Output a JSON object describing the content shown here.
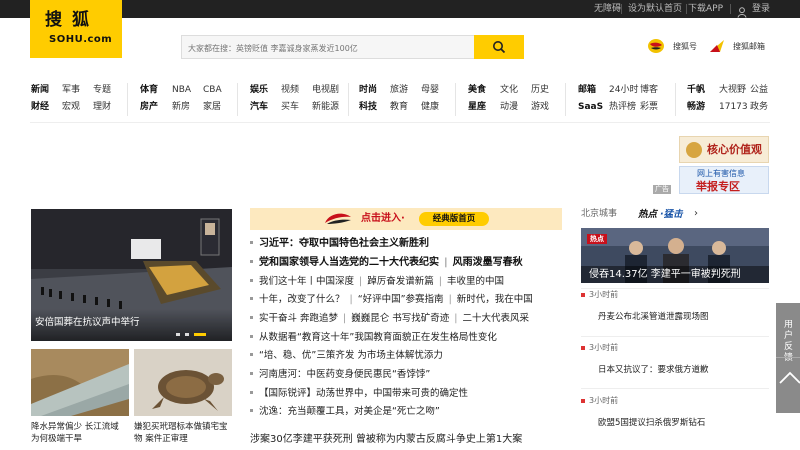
{
  "topbar": {
    "links": [
      "无障碍",
      "设为默认首页",
      "下载APP",
      "登录"
    ]
  },
  "logo": {
    "cn": "搜狐",
    "en": "SOHU.com"
  },
  "search": {
    "placeholder": "大家都在搜：英镑贬值 李嘉诚身家蒸发近100亿"
  },
  "header_links": {
    "sohuhao": "搜狐号",
    "mail": "搜狐邮箱"
  },
  "nav": {
    "groups": [
      {
        "row1": [
          "新闻",
          "军事",
          "专题"
        ],
        "row2": [
          "财经",
          "宏观",
          "理财"
        ]
      },
      {
        "row1": [
          "体育",
          "NBA",
          "CBA"
        ],
        "row2": [
          "房产",
          "新房",
          "家居"
        ]
      },
      {
        "row1": [
          "娱乐",
          "视频",
          "电视剧"
        ],
        "row2": [
          "汽车",
          "买车",
          "新能源"
        ]
      },
      {
        "row1": [
          "时尚",
          "旅游",
          "母婴"
        ],
        "row2": [
          "科技",
          "教育",
          "健康"
        ]
      },
      {
        "row1": [
          "美食",
          "文化",
          "历史"
        ],
        "row2": [
          "星座",
          "动漫",
          "游戏"
        ]
      },
      {
        "row1": [
          "邮箱",
          "24小时",
          "博客"
        ],
        "row2": [
          "SaaS",
          "热评榜",
          "彩票"
        ]
      },
      {
        "row1": [
          "千帆",
          "大视野",
          "公益"
        ],
        "row2": [
          "畅游",
          "17173",
          "政务"
        ]
      }
    ]
  },
  "ads": {
    "ad1_text": "核心价值观",
    "ad2_line1": "网上有害信息",
    "ad2_line2": "举报专区",
    "ad_label": "广告"
  },
  "carousel": {
    "caption": "安倍国葬在抗议声中举行"
  },
  "thumbs": [
    {
      "line1": "降水异常偏少 长江流域",
      "line2": "为何极端干旱"
    },
    {
      "line1": "嫌犯买玳瑁标本做镇宅宝",
      "line2": "物 案件正审理"
    }
  ],
  "banner": {
    "text": "点击进入·",
    "button": "经典版首页"
  },
  "news": [
    {
      "items": [
        "习近平：夺取中国特色社会主义新胜利"
      ],
      "headline": true
    },
    {
      "items": [
        "党和国家领导人当选党的二十大代表纪实",
        "风雨泼墨写春秋"
      ],
      "headline": true
    },
    {
      "items": [
        "我们这十年丨中国深度",
        "踔厉奋发谱新篇",
        "丰收里的中国"
      ],
      "headline": false
    },
    {
      "items": [
        "十年，改变了什么？",
        "“好评中国”参赛指南",
        "新时代，我在中国"
      ],
      "headline": false
    },
    {
      "items": [
        "实干奋斗 奔跑追梦",
        "巍巍昆仑 书写找矿奇迹",
        "二十大代表风采"
      ],
      "headline": false
    },
    {
      "items": [
        "从数据看“教育这十年”我国教育面貌正在发生格局性变化"
      ],
      "headline": false
    },
    {
      "items": [
        "“培、稳、优”三策齐发 为市场主体解忧添力"
      ],
      "headline": false
    },
    {
      "items": [
        "河南唐河：中医药变身便民惠民“香饽饽”"
      ],
      "headline": false
    },
    {
      "items": [
        "【国际锐评】动荡世界中，中国带来可贵的确定性"
      ],
      "headline": false
    },
    {
      "items": [
        "沈逸：充当颠覆工具，对美企是“死亡之吻”"
      ],
      "headline": false
    },
    {
      "items": [
        "涉案30亿李建平获死刑 曾被称为内蒙古反腐斗争史上第1大案"
      ],
      "headline": false
    }
  ],
  "right": {
    "tab1": "北京城事",
    "tab2": "热点",
    "tab2_suffix": "·猛击",
    "feature_badge": "热点",
    "feature_caption": "侵吞14.37亿 李建平一审被判死刑",
    "items": [
      {
        "time": "3小时前",
        "title": "丹麦公布北溪管道泄露现场图"
      },
      {
        "time": "3小时前",
        "title": "日本又抗议了：要求俄方道歉"
      },
      {
        "time": "3小时前",
        "title": "欧盟5国提议扫杀俄罗斯钻石"
      }
    ]
  },
  "floatpanel": {
    "text": "用户反馈"
  }
}
